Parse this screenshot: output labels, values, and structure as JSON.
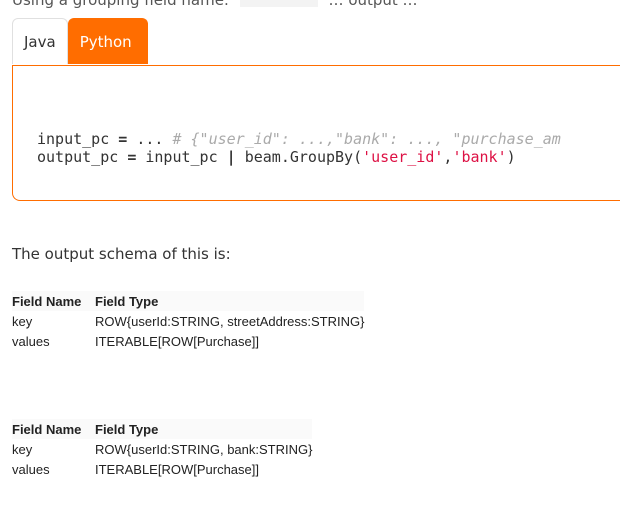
{
  "top_fragment": {
    "left": "Using a grouping field name:",
    "right": "… output …"
  },
  "tabs": [
    {
      "label": "Java",
      "active": false
    },
    {
      "label": "Python",
      "active": true
    }
  ],
  "code": {
    "line1": {
      "var": "input_pc",
      "op": "=",
      "dots": "...",
      "comment": "# {\"user_id\": ...,\"bank\": ..., \"purchase_am"
    },
    "line2": {
      "var": "output_pc",
      "op": "=",
      "src": "input_pc",
      "pipe": "|",
      "call": "beam.GroupBy(",
      "arg1": "'user_id'",
      "comma": ",",
      "arg2": "'bank'",
      "close": ")"
    }
  },
  "paragraph": "The output schema of this is:",
  "tables": [
    {
      "headers": [
        "Field Name",
        "Field Type"
      ],
      "rows": [
        [
          "key",
          "ROW{userId:STRING, streetAddress:STRING}"
        ],
        [
          "values",
          "ITERABLE[ROW[Purchase]]"
        ]
      ]
    },
    {
      "headers": [
        "Field Name",
        "Field Type"
      ],
      "rows": [
        [
          "key",
          "ROW{userId:STRING, bank:STRING}"
        ],
        [
          "values",
          "ITERABLE[ROW[Purchase]]"
        ]
      ]
    }
  ],
  "colors": {
    "accent": "#ff6d00"
  }
}
